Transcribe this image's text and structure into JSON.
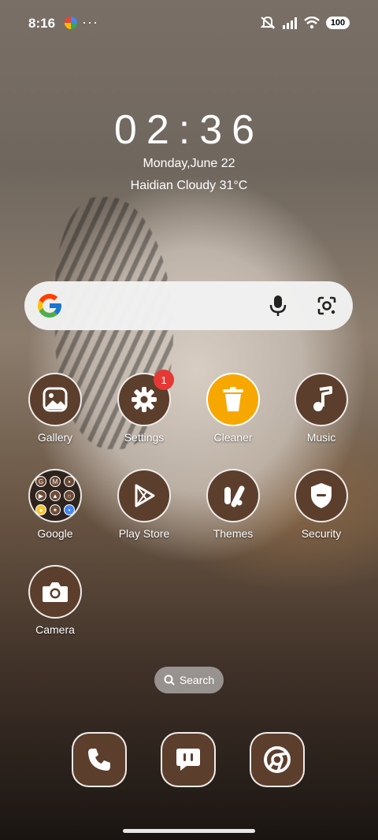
{
  "status_bar": {
    "time": "8:16",
    "overflow": "···",
    "icons": [
      "app-notification-icon",
      "mute-icon",
      "signal-icon",
      "wifi-icon"
    ],
    "battery": "100"
  },
  "clock_widget": {
    "time": "02:36",
    "date": "Monday,June 22",
    "weather": "Haidian Cloudy 31°C"
  },
  "search_bar": {
    "icons": [
      "google-g-icon",
      "mic-icon",
      "google-lens-icon"
    ]
  },
  "apps": [
    {
      "id": "gallery",
      "label": "Gallery",
      "icon": "gallery-icon"
    },
    {
      "id": "settings",
      "label": "Settings",
      "icon": "gear-icon",
      "badge": "1"
    },
    {
      "id": "cleaner",
      "label": "Cleaner",
      "icon": "trash-icon"
    },
    {
      "id": "music",
      "label": "Music",
      "icon": "music-note-icon"
    },
    {
      "id": "google",
      "label": "Google",
      "icon": "folder-icon"
    },
    {
      "id": "play_store",
      "label": "Play Store",
      "icon": "play-icon"
    },
    {
      "id": "themes",
      "label": "Themes",
      "icon": "themes-icon"
    },
    {
      "id": "security",
      "label": "Security",
      "icon": "shield-icon"
    },
    {
      "id": "camera",
      "label": "Camera",
      "icon": "camera-icon"
    }
  ],
  "google_folder_preview": [
    "G",
    "M",
    "•",
    "▶",
    "▲",
    "○",
    "●",
    "✶",
    "•"
  ],
  "home_search": {
    "label": "Search",
    "icon": "search-icon"
  },
  "dock": [
    {
      "id": "phone",
      "icon": "phone-icon"
    },
    {
      "id": "messages",
      "icon": "message-icon"
    },
    {
      "id": "chrome",
      "icon": "chrome-icon"
    }
  ],
  "colors": {
    "accent_icon_bg": "#5c3e2c",
    "cleaner_bg": "#f6a800",
    "badge": "#e53935"
  }
}
